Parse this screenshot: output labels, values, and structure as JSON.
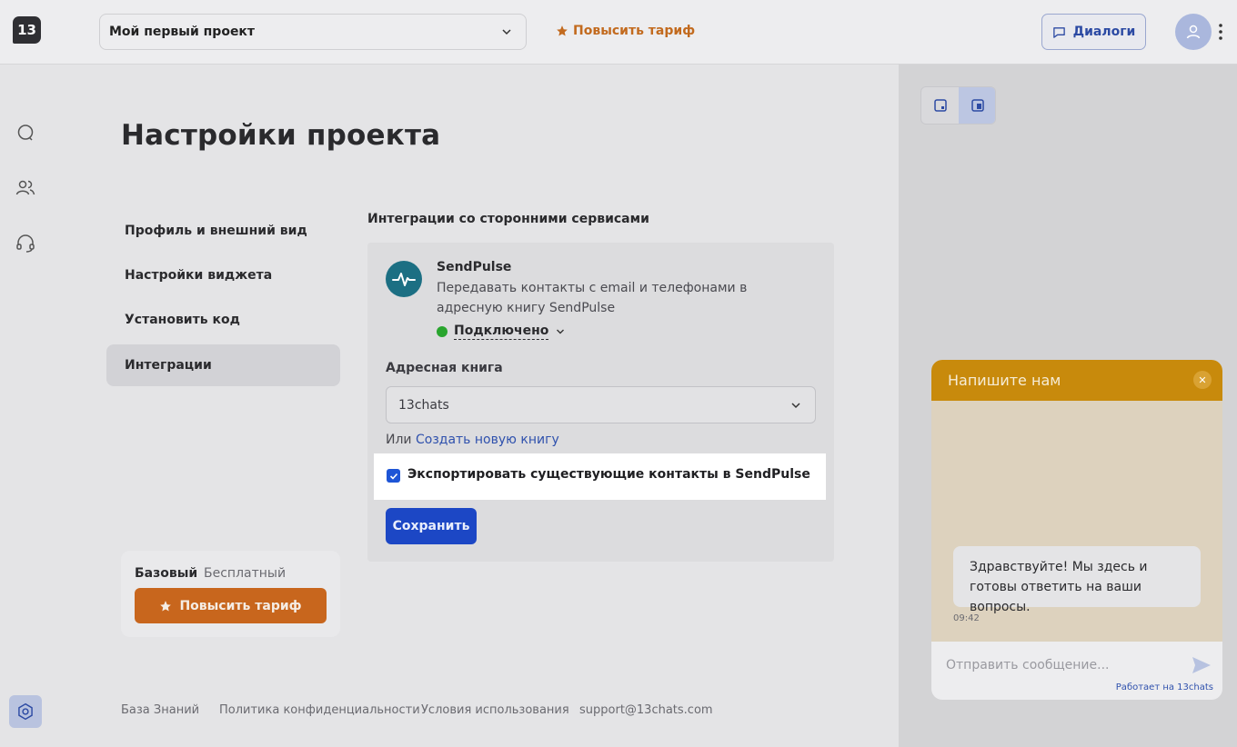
{
  "header": {
    "logo_text": "13",
    "project_name": "Мой первый проект",
    "upgrade_label": "Повысить тариф",
    "dialogs_label": "Диалоги"
  },
  "sidebar_icons": [
    "chat-icon",
    "contacts-icon",
    "support-icon",
    "settings-icon"
  ],
  "page": {
    "title": "Настройки проекта",
    "nav": [
      {
        "label": "Профиль и внешний вид",
        "active": false
      },
      {
        "label": "Настройки виджета",
        "active": false
      },
      {
        "label": "Установить код",
        "active": false
      },
      {
        "label": "Интеграции",
        "active": true
      }
    ],
    "plan": {
      "name": "Базовый",
      "type": "Бесплатный",
      "upgrade_label": "Повысить тариф"
    },
    "section_title": "Интеграции со сторонними сервисами",
    "integration": {
      "name": "SendPulse",
      "description": "Передавать контакты с email и телефонами в адресную книгу SendPulse",
      "status": "Подключено",
      "status_color": "#29a52e",
      "book_label": "Адресная книга",
      "book_value": "13chats",
      "or_text": "Или",
      "create_link": "Создать новую книгу",
      "export_label": "Экспортировать существующие контакты в SendPulse",
      "export_checked": true,
      "save_label": "Сохранить"
    },
    "footer": [
      "База Знаний",
      "Политика конфиденциальности",
      "Условия использования",
      "support@13chats.com"
    ]
  },
  "widget": {
    "header_title": "Напишите нам",
    "header_color": "#c88a0c",
    "message": "Здравствуйте! Мы здесь и готовы ответить на ваши вопросы.",
    "time": "09:42",
    "input_placeholder": "Отправить сообщение...",
    "powered_by": "Работает на 13chats"
  },
  "colors": {
    "accent": "#1c47c5",
    "upgrade": "#c8661d"
  }
}
